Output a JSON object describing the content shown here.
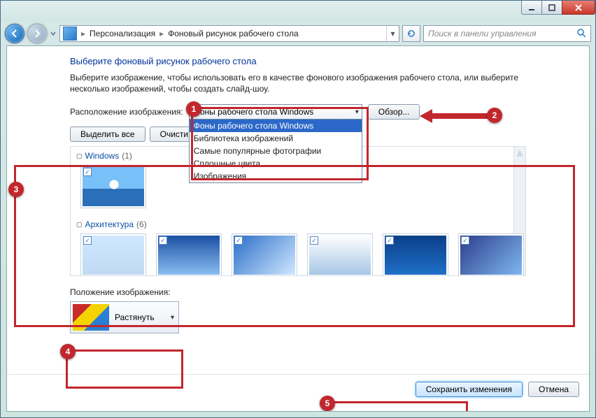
{
  "titlebar": {},
  "nav": {
    "breadcrumb1": "Персонализация",
    "breadcrumb2": "Фоновый рисунок рабочего стола",
    "search_placeholder": "Поиск в панели управления"
  },
  "main": {
    "heading": "Выберите фоновый рисунок рабочего стола",
    "desc": "Выберите изображение, чтобы использовать его в качестве фонового изображения рабочего стола, или выберите несколько изображений, чтобы создать слайд-шоу.",
    "location_label": "Расположение изображения:",
    "location_selected": "Фоны рабочего стола Windows",
    "location_options": [
      "Фоны рабочего стола Windows",
      "Библиотека изображений",
      "Самые популярные фотографии",
      "Сплошные цвета",
      "Изображения"
    ],
    "browse_btn": "Обзор...",
    "select_all_btn": "Выделить все",
    "clear_btn": "Очисти",
    "groups": [
      {
        "name": "Windows",
        "count": "(1)"
      },
      {
        "name": "Архитектура",
        "count": "(6)"
      }
    ],
    "position_label": "Положение изображения:",
    "position_value": "Растянуть",
    "save_btn": "Сохранить изменения",
    "cancel_btn": "Отмена"
  },
  "callouts": {
    "c1": "1",
    "c2": "2",
    "c3": "3",
    "c4": "4",
    "c5": "5"
  }
}
